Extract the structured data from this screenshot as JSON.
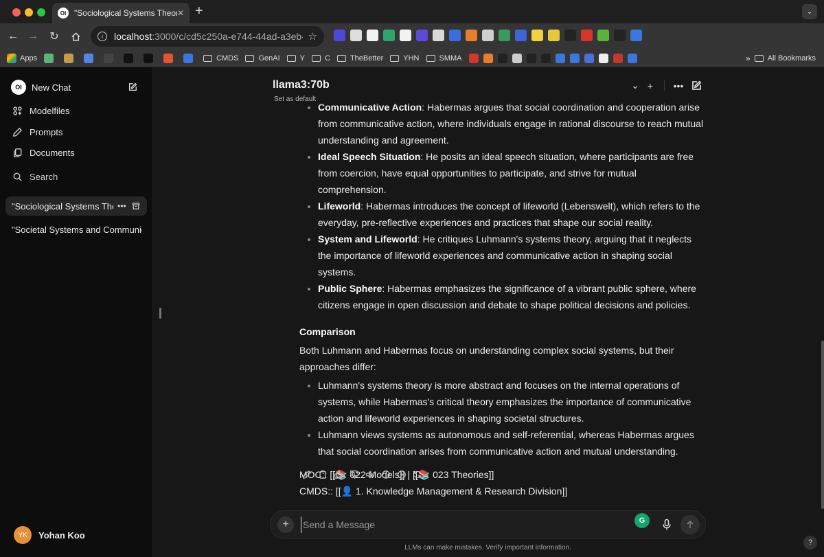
{
  "browser": {
    "tab_title": "\"Sociological Systems Theor",
    "tab_favicon_text": "OI",
    "url_host": "localhost",
    "url_rest": ":3000/c/cd5c250a-e744-44ad-a3eb-...",
    "extensions": [
      "ext-1",
      "ext-2",
      "ext-3",
      "ext-4",
      "ext-5",
      "ext-6",
      "ext-7",
      "ext-8",
      "ext-9",
      "ext-10",
      "ext-11",
      "ext-12",
      "ext-13",
      "ext-14",
      "ext-15",
      "ext-16",
      "ext-17",
      "ext-18",
      "ext-19"
    ],
    "bookmarks": [
      {
        "type": "apps",
        "label": "Apps"
      },
      {
        "type": "icon",
        "label": ""
      },
      {
        "type": "icon",
        "label": ""
      },
      {
        "type": "icon",
        "label": ""
      },
      {
        "type": "icon",
        "label": ""
      },
      {
        "type": "icon",
        "label": ""
      },
      {
        "type": "icon",
        "label": ""
      },
      {
        "type": "icon",
        "label": ""
      },
      {
        "type": "icon",
        "label": ""
      },
      {
        "type": "folder",
        "label": "CMDS"
      },
      {
        "type": "folder",
        "label": "GenAI"
      },
      {
        "type": "folder",
        "label": "Y"
      },
      {
        "type": "folder",
        "label": "C"
      },
      {
        "type": "folder",
        "label": "TheBetter"
      },
      {
        "type": "folder",
        "label": "YHN"
      },
      {
        "type": "folder",
        "label": "SMMA"
      }
    ],
    "all_bookmarks": "All Bookmarks"
  },
  "sidebar": {
    "new_chat": "New Chat",
    "logo_text": "OI",
    "nav": [
      {
        "label": "Modelfiles"
      },
      {
        "label": "Prompts"
      },
      {
        "label": "Documents"
      },
      {
        "label": "Search"
      }
    ],
    "chats": [
      {
        "title": "\"Sociological Systems Theory\"",
        "active": true
      },
      {
        "title": "\"Societal Systems and Communication\"",
        "active": false
      }
    ],
    "user": {
      "initials": "YK",
      "name": "Yohan Koo"
    }
  },
  "header": {
    "model": "llama3:70b",
    "set_default": "Set as default"
  },
  "message": {
    "bullets_habermas": [
      {
        "term": "Communicative Action",
        "text": ": Habermas argues that social coordination and cooperation arise from communicative action, where individuals engage in rational discourse to reach mutual understanding and agreement."
      },
      {
        "term": "Ideal Speech Situation",
        "text": ": He posits an ideal speech situation, where participants are free from coercion, have equal opportunities to participate, and strive for mutual comprehension."
      },
      {
        "term": "Lifeworld",
        "text": ": Habermas introduces the concept of lifeworld (Lebenswelt), which refers to the everyday, pre-reflective experiences and practices that shape our social reality."
      },
      {
        "term": "System and Lifeworld",
        "text": ": He critiques Luhmann's systems theory, arguing that it neglects the importance of lifeworld experiences and communicative action in shaping social systems."
      },
      {
        "term": "Public Sphere",
        "text": ": Habermas emphasizes the significance of a vibrant public sphere, where citizens engage in open discussion and debate to shape political decisions and policies."
      }
    ],
    "comparison_heading": "Comparison",
    "comparison_intro": "Both Luhmann and Habermas focus on understanding complex social systems, but their approaches differ:",
    "comparison_bullets": [
      "Luhmann's systems theory is more abstract and focuses on the internal operations of systems, while Habermas's critical theory emphasizes the importance of communicative action and lifeworld experiences in shaping societal structures.",
      "Luhmann views systems as autonomous and self-referential, whereas Habermas argues that social coordination arises from communicative action and mutual understanding."
    ],
    "moc_line": "MOC:: [[📚 022 Models]] | [[📚 023 Theories]]",
    "cmds_line": "CMDS:: [[👤 1. Knowledge Management & Research Division]]"
  },
  "composer": {
    "placeholder": "Send a Message",
    "grammarly": "G",
    "disclaimer": "LLMs can make mistakes. Verify important information.",
    "help": "?"
  }
}
